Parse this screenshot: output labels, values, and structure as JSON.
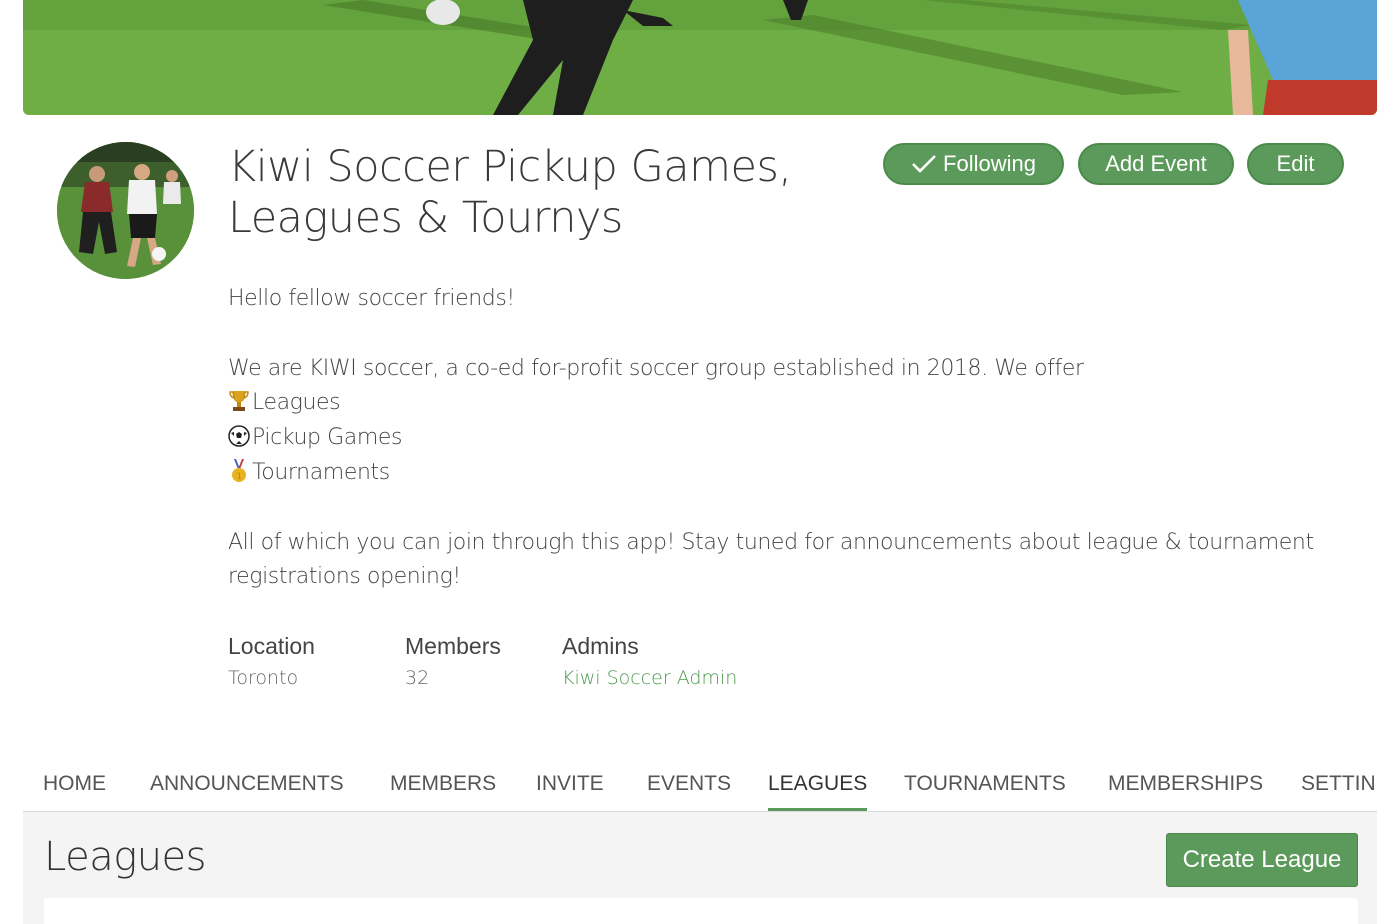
{
  "group": {
    "title": "Kiwi Soccer Pickup Games, Leagues & Tournys"
  },
  "actions": {
    "following_label": "Following",
    "add_event_label": "Add Event",
    "edit_label": "Edit"
  },
  "description": {
    "greeting": "Hello fellow soccer friends!",
    "intro": "We are KIWI soccer, a co-ed for-profit soccer group established in 2018. We offer",
    "offerings": [
      {
        "icon": "trophy-icon",
        "label": "Leagues"
      },
      {
        "icon": "soccer-ball-icon",
        "label": "Pickup Games"
      },
      {
        "icon": "medal-icon",
        "label": "Tournaments"
      }
    ],
    "closing": "All of which you can join through this app! Stay tuned for announcements about league & tournament registrations opening!"
  },
  "stats": {
    "location_label": "Location",
    "location_value": "Toronto",
    "members_label": "Members",
    "members_value": "32",
    "admins_label": "Admins",
    "admins_value": "Kiwi Soccer Admin"
  },
  "tabs": [
    {
      "label": "HOME"
    },
    {
      "label": "ANNOUNCEMENTS"
    },
    {
      "label": "MEMBERS"
    },
    {
      "label": "INVITE"
    },
    {
      "label": "EVENTS"
    },
    {
      "label": "LEAGUES",
      "active": true
    },
    {
      "label": "TOURNAMENTS"
    },
    {
      "label": "MEMBERSHIPS"
    },
    {
      "label": "SETTIN"
    }
  ],
  "leagues": {
    "title": "Leagues",
    "create_label": "Create League"
  },
  "colors": {
    "accent": "#5b9a5b",
    "link": "#4e9a4e"
  }
}
